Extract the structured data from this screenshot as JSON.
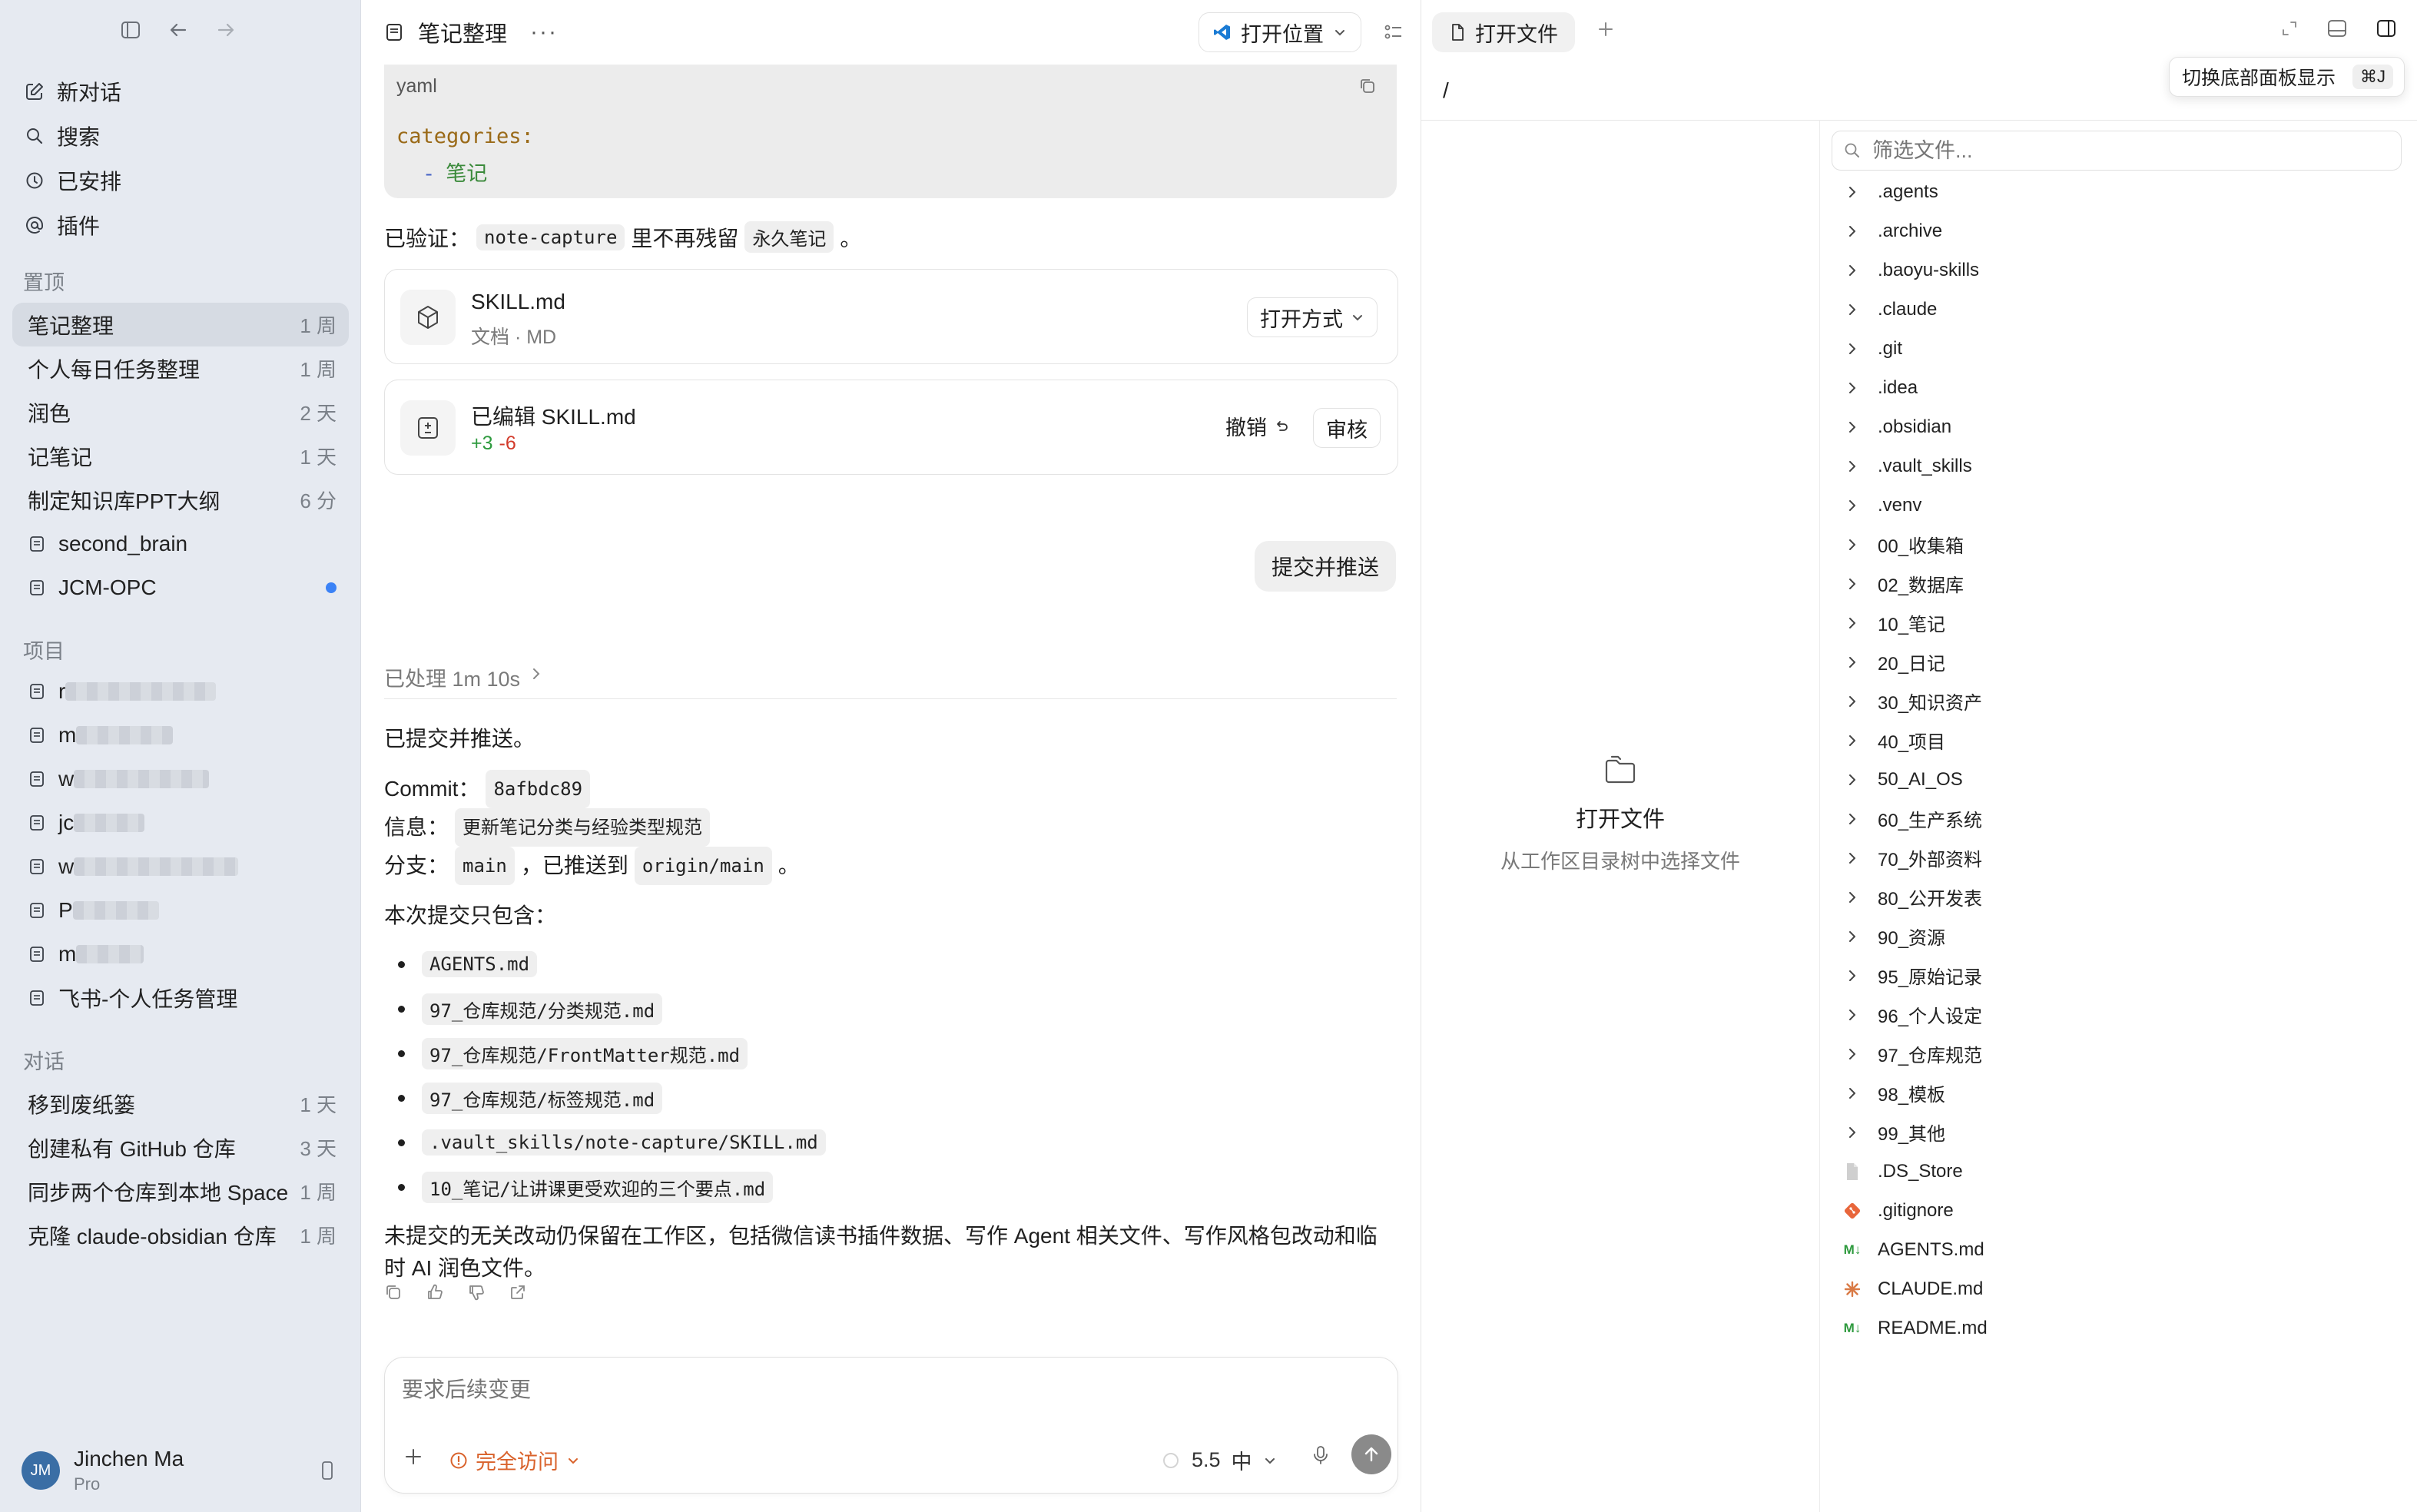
{
  "sidebar": {
    "nav": [
      {
        "label": "新对话",
        "icon": "compose-icon"
      },
      {
        "label": "搜索",
        "icon": "search-icon"
      },
      {
        "label": "已安排",
        "icon": "clock-icon"
      },
      {
        "label": "插件",
        "icon": "at-icon"
      }
    ],
    "pinned_title": "置顶",
    "pinned": [
      {
        "label": "笔记整理",
        "time": "1 周",
        "active": true
      },
      {
        "label": "个人每日任务整理",
        "time": "1 周"
      },
      {
        "label": "润色",
        "time": "2 天"
      },
      {
        "label": "记笔记",
        "time": "1 天"
      },
      {
        "label": "制定知识库PPT大纲",
        "time": "6 分"
      },
      {
        "label": "second_brain",
        "time": "",
        "icon": "doc-icon"
      },
      {
        "label": "JCM-OPC",
        "time": "",
        "icon": "doc-icon",
        "dot": true
      }
    ],
    "projects_title": "项目",
    "projects": [
      {
        "label": "r",
        "blurred": true
      },
      {
        "label": "m",
        "blurred": true
      },
      {
        "label": "w",
        "blurred": true
      },
      {
        "label": "jc",
        "blurred": true
      },
      {
        "label": "w",
        "blurred": true
      },
      {
        "label": "P",
        "blurred": true
      },
      {
        "label": "m",
        "blurred": true
      },
      {
        "label": "飞书-个人任务管理",
        "blurred": false
      }
    ],
    "convos_title": "对话",
    "convos": [
      {
        "label": "移到废纸篓",
        "time": "1 天"
      },
      {
        "label": "创建私有 GitHub 仓库",
        "time": "3 天"
      },
      {
        "label": "同步两个仓库到本地 Space",
        "time": "1 周"
      },
      {
        "label": "克隆 claude-obsidian 仓库",
        "time": "1 周"
      }
    ],
    "user": {
      "initials": "JM",
      "name": "Jinchen Ma",
      "plan": "Pro"
    }
  },
  "header": {
    "title": "笔记整理",
    "more": "···",
    "open_location": "打开位置"
  },
  "code_block": {
    "lang": "yaml",
    "line1": "categories:",
    "line2_dash": "-",
    "line2_value": "笔记"
  },
  "verified": {
    "prefix": "已验证：",
    "code1": "note-capture",
    "middle": "里不再残留",
    "code2": "永久笔记",
    "suffix": "。"
  },
  "file_card": {
    "title": "SKILL.md",
    "subtitle": "文档 · MD",
    "open_with": "打开方式"
  },
  "edit_card": {
    "title": "已编辑 SKILL.md",
    "additions": "+3",
    "deletions": "-6",
    "undo": "撤销",
    "review": "审核"
  },
  "user_message": "提交并推送",
  "processed": "已处理 1m 10s",
  "reply": {
    "intro": "已提交并推送。",
    "commit_label": "Commit：",
    "commit_hash": "8afbdc89",
    "info_label": "信息：",
    "info_value": "更新笔记分类与经验类型规范",
    "branch_label": "分支：",
    "branch_value": "main",
    "pushed_text": "，已推送到",
    "remote_value": "origin/main",
    "end": "。",
    "list_intro": "本次提交只包含：",
    "files": [
      "AGENTS.md",
      "97_仓库规范/分类规范.md",
      "97_仓库规范/FrontMatter规范.md",
      "97_仓库规范/标签规范.md",
      ".vault_skills/note-capture/SKILL.md",
      "10_笔记/让讲课更受欢迎的三个要点.md"
    ],
    "footer": "未提交的无关改动仍保留在工作区，包括微信读书插件数据、写作 Agent 相关文件、写作风格包改动和临时 AI 润色文件。"
  },
  "composer": {
    "placeholder": "要求后续变更",
    "access": "完全访问",
    "model": "5.5",
    "effort": "中"
  },
  "right_panel": {
    "tab_label": "打开文件",
    "tooltip": "切换底部面板显示",
    "shortcut": "⌘J",
    "path": "/",
    "empty_title": "打开文件",
    "empty_subtitle": "从工作区目录树中选择文件",
    "filter_placeholder": "筛选文件...",
    "tree": [
      {
        "name": ".agents",
        "type": "folder"
      },
      {
        "name": ".archive",
        "type": "folder"
      },
      {
        "name": ".baoyu-skills",
        "type": "folder"
      },
      {
        "name": ".claude",
        "type": "folder"
      },
      {
        "name": ".git",
        "type": "folder"
      },
      {
        "name": ".idea",
        "type": "folder"
      },
      {
        "name": ".obsidian",
        "type": "folder"
      },
      {
        "name": ".vault_skills",
        "type": "folder"
      },
      {
        "name": ".venv",
        "type": "folder"
      },
      {
        "name": "00_收集箱",
        "type": "folder"
      },
      {
        "name": "02_数据库",
        "type": "folder"
      },
      {
        "name": "10_笔记",
        "type": "folder"
      },
      {
        "name": "20_日记",
        "type": "folder"
      },
      {
        "name": "30_知识资产",
        "type": "folder"
      },
      {
        "name": "40_项目",
        "type": "folder"
      },
      {
        "name": "50_AI_OS",
        "type": "folder"
      },
      {
        "name": "60_生产系统",
        "type": "folder"
      },
      {
        "name": "70_外部资料",
        "type": "folder"
      },
      {
        "name": "80_公开发表",
        "type": "folder"
      },
      {
        "name": "90_资源",
        "type": "folder"
      },
      {
        "name": "95_原始记录",
        "type": "folder"
      },
      {
        "name": "96_个人设定",
        "type": "folder"
      },
      {
        "name": "97_仓库规范",
        "type": "folder"
      },
      {
        "name": "98_模板",
        "type": "folder"
      },
      {
        "name": "99_其他",
        "type": "folder"
      },
      {
        "name": ".DS_Store",
        "type": "file"
      },
      {
        "name": ".gitignore",
        "type": "git"
      },
      {
        "name": "AGENTS.md",
        "type": "md"
      },
      {
        "name": "CLAUDE.md",
        "type": "claude"
      },
      {
        "name": "README.md",
        "type": "md"
      }
    ]
  },
  "colors": {
    "sidebar_bg": "#e6eaf1",
    "accent_orange": "#d9622b",
    "diff_add": "#2e9a3e",
    "diff_del": "#d23a2a",
    "unread_dot": "#3b82f6"
  }
}
